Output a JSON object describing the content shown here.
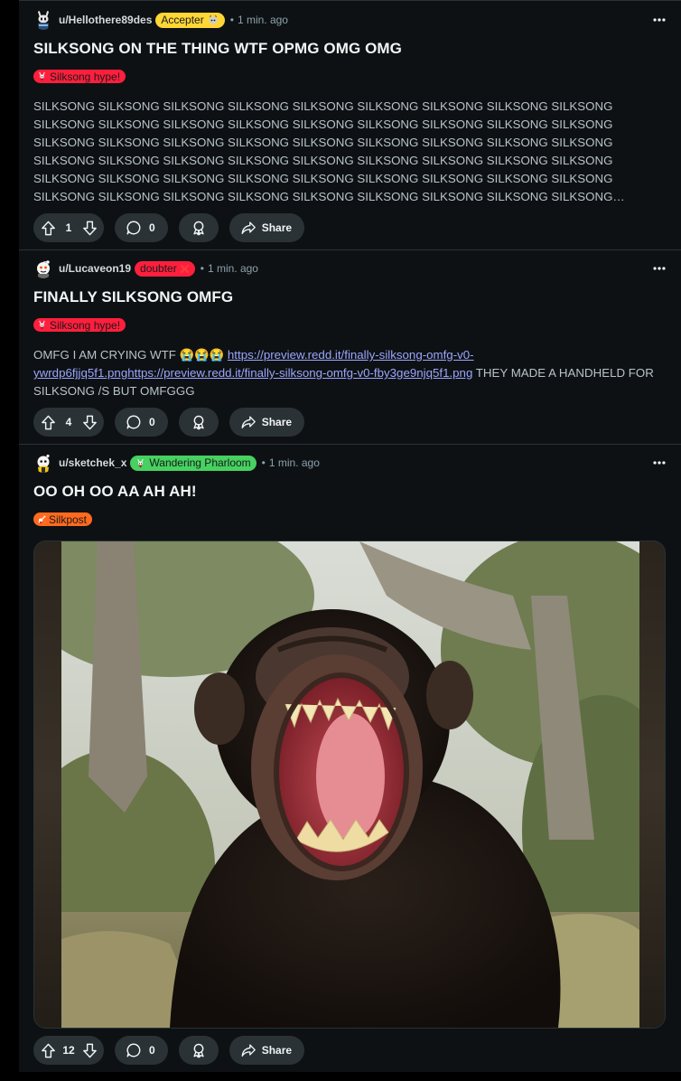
{
  "colors": {
    "background": "#0e1113",
    "action_pill": "#2a3236",
    "link": "#9aa6ff",
    "meta_text": "#8ba2ad",
    "flair_silksong_hype": "#ff1f3d",
    "flair_silkpost": "#ff6a1f",
    "flair_accepter": "#ffd635",
    "flair_doubter": "#ff1f3d",
    "flair_wandering_pharloom": "#46d160"
  },
  "posts": [
    {
      "username": "u/Hellothere89des",
      "user_flair": "Accepter",
      "user_flair_icon": "knight-emoji",
      "separator": "•",
      "time": "1 min. ago",
      "title": "SILKSONG ON THE THING WTF OPMG OMG OMG",
      "post_flair": "Silksong hype!",
      "post_flair_icon": "hornet-emoji",
      "body": "SILKSONG SILKSONG SILKSONG SILKSONG SILKSONG SILKSONG SILKSONG SILKSONG SILKSONG SILKSONG SILKSONG SILKSONG SILKSONG SILKSONG SILKSONG SILKSONG SILKSONG SILKSONG SILKSONG SILKSONG SILKSONG SILKSONG SILKSONG SILKSONG SILKSONG SILKSONG SILKSONG SILKSONG SILKSONG SILKSONG SILKSONG SILKSONG SILKSONG SILKSONG SILKSONG SILKSONG SILKSONG SILKSONG SILKSONG SILKSONG SILKSONG SILKSONG SILKSONG SILKSONG SILKSONG SILKSONG SILKSONG SILKSONG SILKSONG SILKSONG SILKSONG SILKSONG SILKSONG SILKSONG SILKSONG SILKSONG SILKSONG SILKSONG SILKSONG SILKSONG SILKSONG SILKSONG SILKSONG SILKSONG SILKSONG SILKSONG...",
      "votes": "1",
      "comments": "0",
      "share_label": "Share"
    },
    {
      "username": "u/Lucaveon19",
      "user_flair": "doubter",
      "user_flair_icon": "red-x-icon",
      "separator": "•",
      "time": "1 min. ago",
      "title": "FINALLY SILKSONG OMFG",
      "post_flair": "Silksong hype!",
      "post_flair_icon": "hornet-emoji",
      "body_before": "OMFG I AM CRYING WTF 😭😭😭 ",
      "body_link": "https://preview.redd.it/finally-silksong-omfg-v0-ywrdp6fjjq5f1.pnghttps://preview.redd.it/finally-silksong-omfg-v0-fby3ge9njq5f1.png",
      "body_after": " THEY MADE A HANDHELD FOR SILKSONG /S BUT OMFGGG",
      "votes": "4",
      "comments": "0",
      "share_label": "Share"
    },
    {
      "username": "u/sketchek_x",
      "user_flair": "Wandering Pharloom",
      "user_flair_icon": "hornet-emoji",
      "separator": "•",
      "time": "1 min. ago",
      "title": "OO OH OO AA AH AH!",
      "post_flair": "Silkpost",
      "post_flair_icon": "hornet-needle-emoji",
      "image_alt": "laughing chimpanzee",
      "votes": "12",
      "comments": "0",
      "share_label": "Share"
    }
  ]
}
